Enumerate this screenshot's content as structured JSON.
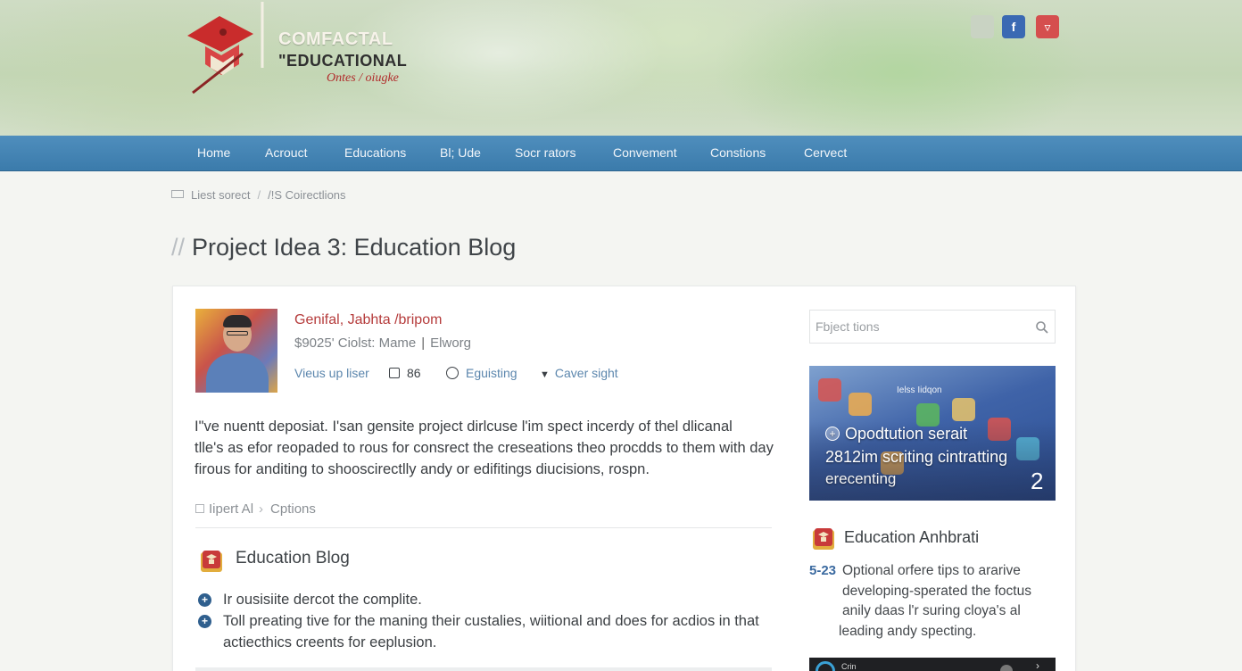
{
  "brand": {
    "line1": "COMFACTAL",
    "line2": "\"EDUCATIONAL",
    "tagline": "Ontes / oiugke"
  },
  "social": {
    "facebook_glyph": "f",
    "pinterest_glyph": "▿"
  },
  "nav": {
    "items": [
      "Home",
      "Acrouct",
      "Educations",
      "Bl; Ude",
      "Socr rators",
      "Convement",
      "Constions",
      "Cervect"
    ]
  },
  "breadcrumb": {
    "first": "Liest sorect",
    "separator": "/",
    "second": "/!S  Coirectlions"
  },
  "page": {
    "title_prefix": "//",
    "title": "Project Idea 3: Education Blog"
  },
  "author": {
    "name": "Genifal, Jabhta /bripom",
    "role": "$9025' Ciolst: Mame",
    "role_pipe": "|",
    "role_tag": "Elworg"
  },
  "meta": {
    "views": "Vieus up liser",
    "count": "86",
    "status": "Eguisting",
    "extra": "Caver sight"
  },
  "intro": {
    "lines": [
      "I\"ve nuentt deposiat. I'san gensite project dirlcuse l'im spect incerdy of thel dlicanal",
      "tlle's as efor reopaded to rous for consrect the creseations theo procdds to them with day",
      "firous for anditing to shooscirectlly andy or edifitings diucisions, rospn."
    ]
  },
  "tabs": {
    "first": "Iipert Al",
    "chevron": "›",
    "second": "Cptions"
  },
  "section": {
    "title": "Education Blog",
    "bullets": [
      {
        "text": "Ir ousisiite dercot the complite.",
        "cont": ""
      },
      {
        "text": "Toll preating tive for the maning their custalies, wiitional and does for acdios in that",
        "cont": "actiecthics creents for eeplusion."
      }
    ],
    "bullet_glyph": "+"
  },
  "sidebar": {
    "search_placeholder": "Fbject tions",
    "promo": {
      "top_label": "Ielss Iidqon",
      "title": "Opodtution serait",
      "line2": "2812im scriting cintratting",
      "line3": "erecenting",
      "number": "2",
      "plus_glyph": "+"
    },
    "post": {
      "title": "Education Anhbrati",
      "date": "5-23",
      "lines": [
        "Optional orfere tips to ararive",
        "developing-sperated the foctus",
        "anily daas l'r suring cloya's al",
        "leading andy specting."
      ]
    },
    "dark_tile_label": "Crin"
  },
  "colors": {
    "nav_bg": "#3f80b0",
    "accent_red": "#b53b3b",
    "link_blue": "#5b86ad",
    "bullet_blue": "#2f5f8e"
  },
  "icons": [
    "graduation-cap-logo-icon",
    "facebook-icon",
    "pinterest-icon",
    "document-icon",
    "checkbox-icon",
    "circle-icon",
    "eye-icon",
    "search-icon",
    "book-icon",
    "plus-circle-icon"
  ]
}
